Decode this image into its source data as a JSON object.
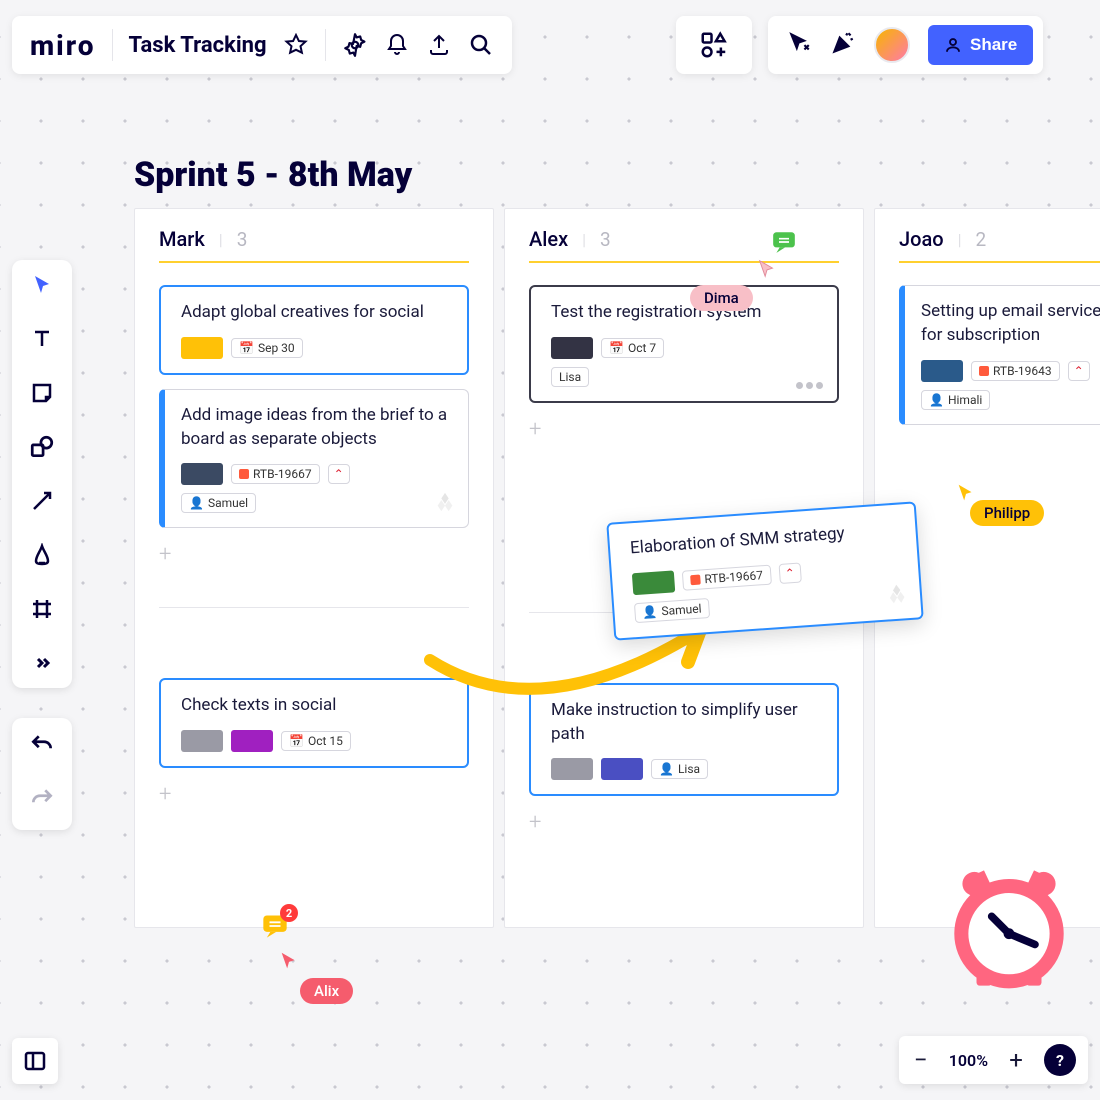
{
  "app": {
    "logo": "miro"
  },
  "header": {
    "board_name": "Task Tracking",
    "share_label": "Share"
  },
  "board": {
    "sprint_title": "Sprint 5 - 8th May"
  },
  "columns": [
    {
      "name": "Mark",
      "count": "3",
      "cards_top": [
        {
          "title": "Adapt global creatives for social",
          "swatches": [
            "yellow"
          ],
          "date": "Sep 30",
          "style": "selected"
        },
        {
          "title": "Add image ideas from the brief to a board as separate objects",
          "swatches": [
            "navy"
          ],
          "jira": "RTB-19667",
          "priority": "high",
          "assignee": "Samuel",
          "jira_cloud": true,
          "style": "blue-left"
        }
      ],
      "cards_bottom": [
        {
          "title": "Check texts in social",
          "swatches": [
            "gray",
            "purple"
          ],
          "date": "Oct 15",
          "style": "selected"
        }
      ]
    },
    {
      "name": "Alex",
      "count": "3",
      "cards_top": [
        {
          "title": "Test the registration system",
          "swatches": [
            "dark"
          ],
          "date": "Oct 7",
          "assignee": "Lisa",
          "cluster": true,
          "style": "dark-sel"
        }
      ],
      "cards_bottom": [
        {
          "title": "Make instruction to simplify user path",
          "swatches": [
            "gray",
            "indigo"
          ],
          "assignee": "Lisa",
          "style": "selected"
        }
      ]
    },
    {
      "name": "Joao",
      "count": "2",
      "cards_top": [
        {
          "title": "Setting up email services for subscription",
          "swatches": [
            "blue"
          ],
          "jira": "RTB-19643",
          "priority": "high",
          "assignee": "Himali",
          "style": "blue-left"
        }
      ],
      "cards_bottom": []
    }
  ],
  "floating_card": {
    "title": "Elaboration of SMM strategy",
    "swatches": [
      "green"
    ],
    "jira": "RTB-19667",
    "priority": "high",
    "assignee": "Samuel"
  },
  "cursors": {
    "dima": "Dima",
    "philipp": "Philipp",
    "alix": "Alix"
  },
  "comment_badge_count": "2",
  "zoom": {
    "level": "100%"
  },
  "help": "?"
}
